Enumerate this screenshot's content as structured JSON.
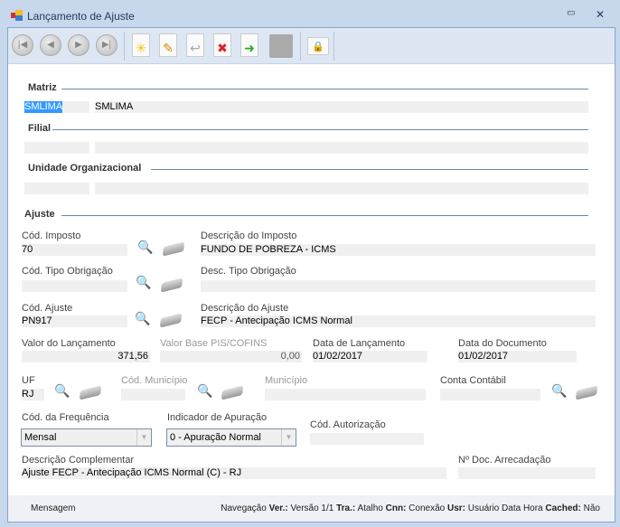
{
  "window": {
    "title": "Lançamento de Ajuste",
    "minimize": "▭",
    "close": "✕"
  },
  "toolbar": {
    "first": "|◀",
    "prev": "◀",
    "next": "▶",
    "last": "▶|",
    "new": "✳",
    "edit": "✎",
    "undo": "↩",
    "delete": "✖",
    "apply": "➜",
    "save": "💾",
    "lock": "🔒"
  },
  "sections": {
    "matriz": "Matriz",
    "filial": "Filial",
    "unidade": "Unidade Organizacional",
    "ajuste": "Ajuste"
  },
  "matriz": {
    "code": "SMLIMA",
    "name": "SMLIMA"
  },
  "filial": {
    "code": "",
    "name": ""
  },
  "unidade": {
    "code": "",
    "name": ""
  },
  "form": {
    "cod_imposto_label": "Cód. Imposto",
    "cod_imposto": "70",
    "desc_imposto_label": "Descrição do Imposto",
    "desc_imposto": "FUNDO DE POBREZA  - ICMS",
    "cod_tipo_obrig_label": "Cód. Tipo Obrigação",
    "cod_tipo_obrig": "",
    "desc_tipo_obrig_label": "Desc. Tipo Obrigação",
    "desc_tipo_obrig": "",
    "cod_ajuste_label": "Cód. Ajuste",
    "cod_ajuste": "PN917",
    "desc_ajuste_label": "Descrição do Ajuste",
    "desc_ajuste": "FECP - Antecipação ICMS Normal",
    "valor_label": "Valor do Lançamento",
    "valor": "371,56",
    "base_label": "Valor Base PIS/COFINS",
    "base": "0,00",
    "data_lanc_label": "Data de Lançamento",
    "data_lanc": "01/02/2017",
    "data_doc_label": "Data do Documento",
    "data_doc": "01/02/2017",
    "uf_label": "UF",
    "uf": "RJ",
    "cod_mun_label": "Cód. Município",
    "cod_mun": "",
    "mun_label": "Município",
    "mun": "",
    "conta_label": "Conta Contábil",
    "conta": "",
    "freq_label": "Cód. da Frequência",
    "freq": "Mensal",
    "ind_label": "Indicador de Apuração",
    "ind": "0 - Apuração Normal",
    "aut_label": "Cód. Autorização",
    "aut": "",
    "desc_comp_label": "Descrição Complementar",
    "desc_comp": "Ajuste FECP - Antecipação ICMS Normal (C) - RJ",
    "doc_arr_label": "Nº Doc. Arrecadação",
    "doc_arr": ""
  },
  "status": {
    "mensagem": "Mensagem",
    "navegacao": "Navegação",
    "ver_k": "Ver.:",
    "ver": "Versão 1/1",
    "tra_k": "Tra.:",
    "tra": "Atalho",
    "cnn_k": "Cnn:",
    "cnn": "Conexão",
    "usr_k": "Usr:",
    "usr": "Usuário",
    "data": "Data",
    "hora": "Hora",
    "cached_k": "Cached:",
    "cached": "Não"
  }
}
